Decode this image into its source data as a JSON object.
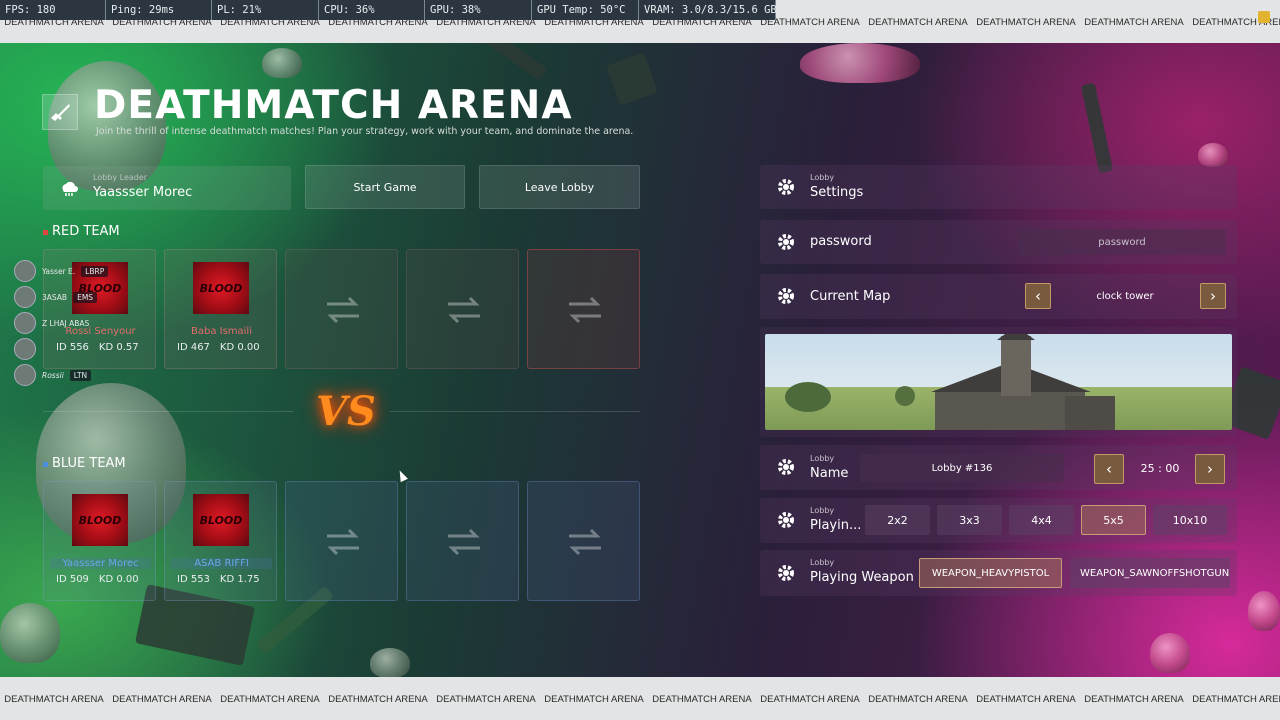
{
  "overlay": {
    "fps": "FPS: 180",
    "ping": "Ping: 29ms",
    "pl": "PL: 21%",
    "cpu": "CPU: 36%",
    "gpu": "GPU: 38%",
    "gpu_temp": "GPU Temp: 50°C",
    "vram": "VRAM: 3.0/8.3/15.6 GB"
  },
  "ticker": {
    "text": "DEATHMATCH ARENA"
  },
  "header": {
    "title": "DEATHMATCH ARENA",
    "subtitle": "Join the thrill of intense deathmatch matches! Plan your strategy, work with your team, and dominate the arena."
  },
  "leader": {
    "label": "Lobby Leader",
    "name": "Yaassser Morec"
  },
  "actions": {
    "start": "Start Game",
    "leave": "Leave Lobby"
  },
  "red_team": {
    "label": "RED TEAM",
    "players": [
      {
        "name": "Rossi Senyour",
        "id": "ID 556",
        "kd": "KD 0.57",
        "logo": "BLOOD"
      },
      {
        "name": "Baba Ismaili",
        "id": "ID 467",
        "kd": "KD 0.00",
        "logo": "BLOOD"
      }
    ]
  },
  "blue_team": {
    "label": "BLUE TEAM",
    "players": [
      {
        "name": "Yaassser Morec",
        "id": "ID 509",
        "kd": "KD 0.00",
        "logo": "BLOOD"
      },
      {
        "name": "ASAB RIFFI",
        "id": "ID 553",
        "kd": "KD 1.75",
        "logo": "BLOOD"
      }
    ]
  },
  "vs": "VS",
  "voice_list": [
    {
      "name": "Yasser E.",
      "tag": "LBRP"
    },
    {
      "name": "3ASAB",
      "tag": "EMS"
    },
    {
      "name": "Z LHAJ ABAS",
      "tag": ""
    },
    {
      "name": "",
      "tag": ""
    },
    {
      "name": "Rossii",
      "tag": "LTN"
    }
  ],
  "settings": {
    "header_label": "Lobby",
    "header_title": "Settings",
    "password_title": "password",
    "password_placeholder": "password",
    "map_title": "Current Map",
    "map_value": "clock tower",
    "name_label": "Lobby",
    "name_title": "Name",
    "name_value": "Lobby #136",
    "timer": "25 : 00",
    "playing_label": "Lobby",
    "playing_title": "Playin...",
    "modes": [
      "2x2",
      "3x3",
      "4x4",
      "5x5",
      "10x10"
    ],
    "selected_mode": "5x5",
    "weapon_label": "Lobby",
    "weapon_title": "Playing Weapon",
    "weapons": [
      "WEAPON_HEAVYPISTOL",
      "WEAPON_SAWNOFFSHOTGUN"
    ],
    "selected_weapon": "WEAPON_HEAVYPISTOL"
  },
  "icons": {
    "title": "rifle-icon",
    "leader": "cloud-user-icon",
    "settings": "gear-icon",
    "swap": "swap-arrows-icon",
    "prev": "chevron-left-icon",
    "next": "chevron-right-icon"
  },
  "colors": {
    "red_accent": "#e36b6b",
    "blue_accent": "#6aa6ee",
    "vs": "#ff8a1e",
    "arrow_button": "#7a5a3e"
  }
}
